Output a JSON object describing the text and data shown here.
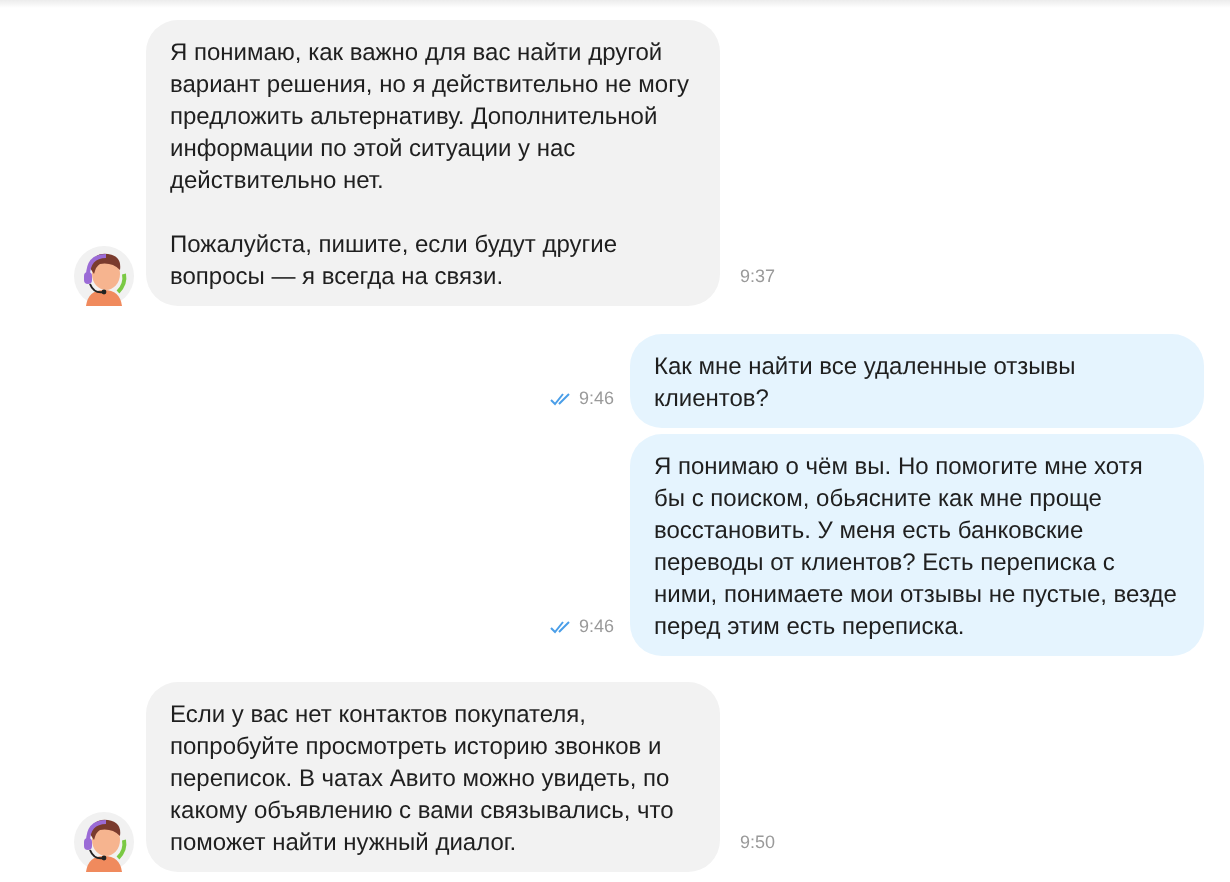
{
  "messages": [
    {
      "kind": "incoming",
      "paragraphs": [
        "Я понимаю, как важно для вас найти другой вариант решения, но я действительно не могу предложить альтернативу. Дополнительной информации по этой ситуации у нас действительно нет.",
        "Пожалуйста, пишите, если будут другие вопросы — я всегда на связи."
      ],
      "time": "9:37"
    },
    {
      "kind": "outgoing",
      "paragraphs": [
        "Как мне найти все удаленные отзывы клиентов?"
      ],
      "time": "9:46",
      "read": true
    },
    {
      "kind": "outgoing",
      "paragraphs": [
        "Я понимаю о чём вы. Но помогите мне хотя бы с поиском, обьясните как мне проще восстановить. У меня есть банковские переводы от клиентов? Есть переписка с ними, понимаете мои отзывы не пустые, везде перед этим есть переписка."
      ],
      "time": "9:46",
      "read": true
    },
    {
      "kind": "incoming",
      "paragraphs": [
        "Если у вас нет контактов покупателя, попробуйте просмотреть историю звонков и переписок. В чатах Авито можно увидеть, по какому объявлению с вами связывались, что поможет найти нужный диалог."
      ],
      "time": "9:50"
    }
  ]
}
